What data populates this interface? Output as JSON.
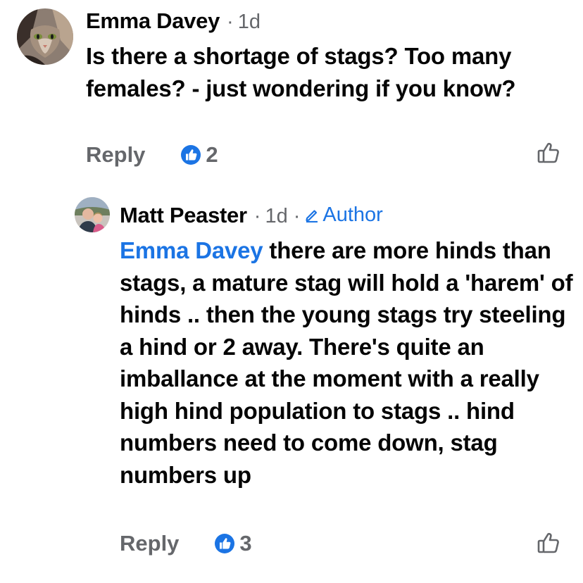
{
  "comments": [
    {
      "author": "Emma Davey",
      "time": "1d",
      "text": "Is there a shortage of stags? Too many females? - just wondering if you know?",
      "reply_label": "Reply",
      "likes": "2"
    },
    {
      "author": "Matt Peaster",
      "time": "1d",
      "badge": "Author",
      "mention": "Emma Davey",
      "text": " there are more hinds than stags, a mature stag will hold a 'harem' of hinds .. then the young stags try steeling a hind or 2 away. There's quite an imballance at the moment with a really high hind population to stags .. hind numbers need to come down, stag numbers up",
      "reply_label": "Reply",
      "likes": "3"
    }
  ],
  "colors": {
    "link": "#1b74e4",
    "secondary": "#65676b",
    "text": "#050505"
  }
}
